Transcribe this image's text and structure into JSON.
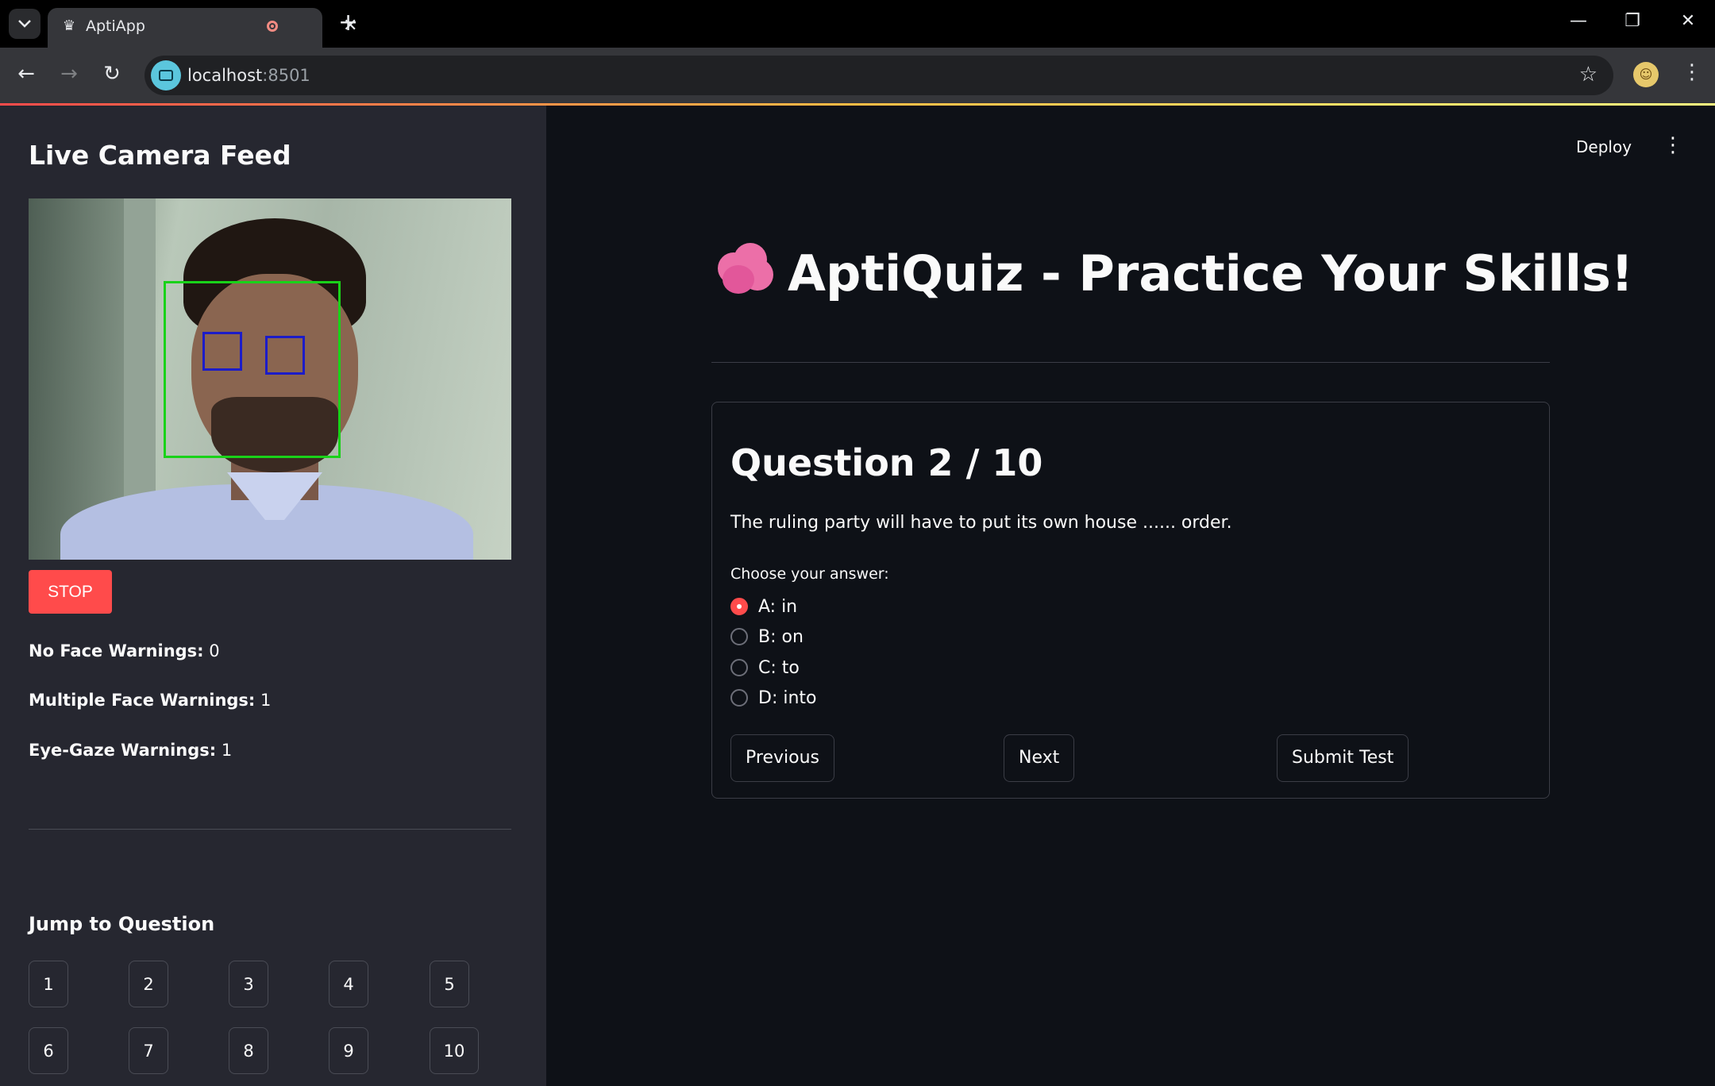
{
  "browser": {
    "tab_title": "AptiApp",
    "url_host": "localhost",
    "url_port": ":8501"
  },
  "sidebar": {
    "title": "Live Camera Feed",
    "stop_label": "STOP",
    "warnings": [
      {
        "label": "No Face Warnings:",
        "value": "0"
      },
      {
        "label": "Multiple Face Warnings:",
        "value": "1"
      },
      {
        "label": "Eye-Gaze Warnings:",
        "value": "1"
      }
    ],
    "jump_title": "Jump to Question",
    "question_buttons": [
      "1",
      "2",
      "3",
      "4",
      "5",
      "6",
      "7",
      "8",
      "9",
      "10"
    ]
  },
  "header": {
    "deploy_label": "Deploy"
  },
  "main": {
    "title": "AptiQuiz - Practice Your Skills!",
    "title_icon": "brain-emoji",
    "question_heading": "Question 2 / 10",
    "question_text": "The ruling party will have to put its own house ...... order.",
    "choose_label": "Choose your answer:",
    "options": [
      "A: in",
      "B: on",
      "C: to",
      "D: into"
    ],
    "selected_option": "A: in",
    "buttons": {
      "previous": "Previous",
      "next": "Next",
      "submit": "Submit Test"
    }
  },
  "colors": {
    "accent": "#ff4b4b",
    "sidebar_bg": "#262730",
    "main_bg": "#0e1117",
    "face_box": "#19d219",
    "eye_box": "#1c1cc8"
  }
}
